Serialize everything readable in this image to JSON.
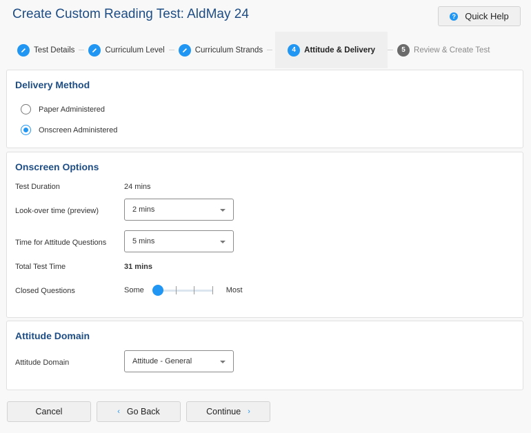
{
  "header": {
    "title": "Create Custom Reading Test: AldMay 24",
    "quick_help_label": "Quick Help",
    "quick_help_icon": "?"
  },
  "stepper": {
    "steps": [
      {
        "label": "Test Details",
        "state": "completed",
        "icon": "pencil-icon"
      },
      {
        "label": "Curriculum Level",
        "state": "completed",
        "icon": "pencil-icon"
      },
      {
        "label": "Curriculum Strands",
        "state": "completed",
        "icon": "pencil-icon"
      },
      {
        "label": "Attitude & Delivery",
        "state": "active",
        "number": "4"
      },
      {
        "label": "Review & Create Test",
        "state": "future",
        "number": "5"
      }
    ]
  },
  "delivery_method": {
    "title": "Delivery Method",
    "options": [
      {
        "label": "Paper Administered",
        "checked": false
      },
      {
        "label": "Onscreen Administered",
        "checked": true
      }
    ]
  },
  "onscreen_options": {
    "title": "Onscreen Options",
    "test_duration_label": "Test Duration",
    "test_duration_value": "24 mins",
    "lookover_label": "Look-over time (preview)",
    "lookover_value": "2 mins",
    "attitude_time_label": "Time for Attitude Questions",
    "attitude_time_value": "5 mins",
    "total_label": "Total Test Time",
    "total_value": "31 mins",
    "closed_questions_label": "Closed Questions",
    "slider_min_label": "Some",
    "slider_max_label": "Most",
    "slider_steps": 4,
    "slider_position": 0
  },
  "attitude_domain": {
    "title": "Attitude Domain",
    "label": "Attitude Domain",
    "value": "Attitude - General"
  },
  "footer": {
    "cancel_label": "Cancel",
    "back_label": "Go Back",
    "continue_label": "Continue",
    "back_icon": "‹",
    "continue_icon": "›"
  }
}
